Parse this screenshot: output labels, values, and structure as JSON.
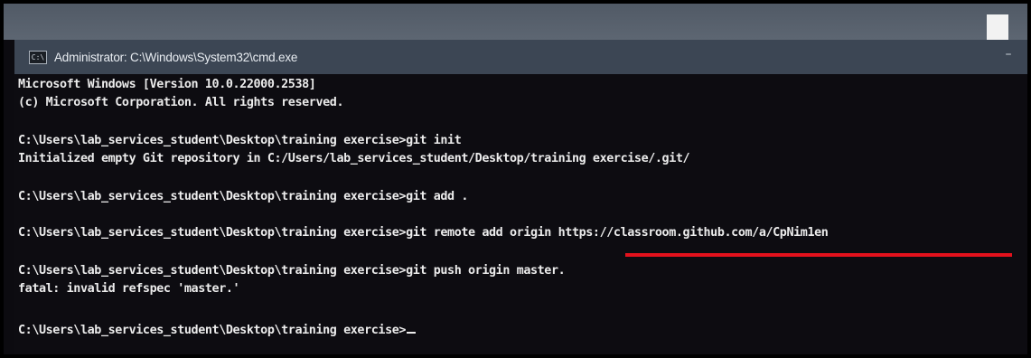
{
  "window": {
    "title": "Administrator: C:\\Windows\\System32\\cmd.exe",
    "icon": "cmd-icon",
    "minimize_glyph": "–"
  },
  "console": {
    "lines": [
      "Microsoft Windows [Version 10.0.22000.2538]",
      "(c) Microsoft Corporation. All rights reserved.",
      "C:\\Users\\lab_services_student\\Desktop\\training exercise>git init",
      "Initialized empty Git repository in C:/Users/lab_services_student/Desktop/training exercise/.git/",
      "C:\\Users\\lab_services_student\\Desktop\\training exercise>git add .",
      "C:\\Users\\lab_services_student\\Desktop\\training exercise>git remote add origin https://classroom.github.com/a/CpNim1en",
      "C:\\Users\\lab_services_student\\Desktop\\training exercise>git push origin master.",
      "fatal: invalid refspec 'master.'",
      "C:\\Users\\lab_services_student\\Desktop\\training exercise>"
    ]
  },
  "colors": {
    "underline": "#e3111c",
    "console_bg": "#0d0c11",
    "titlebar_bg": "#3c4654"
  }
}
